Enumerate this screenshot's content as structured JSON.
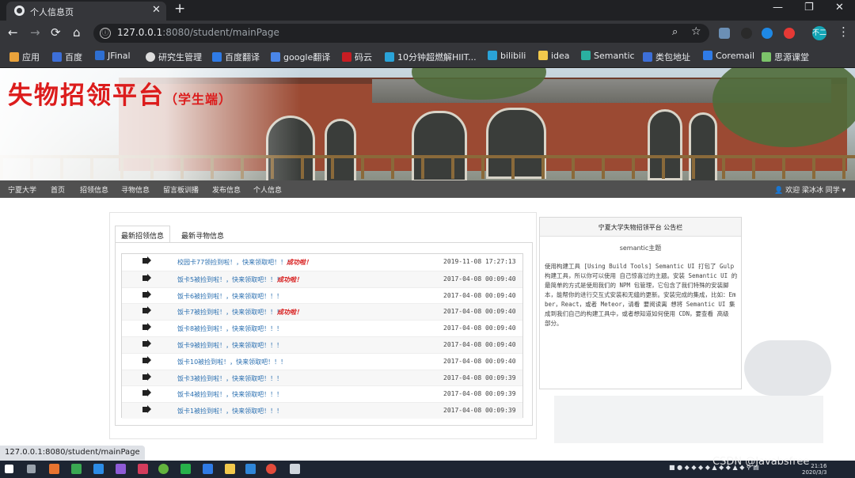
{
  "browser": {
    "tab_title": "个人信息页",
    "tab_close": "✕",
    "new_tab": "+",
    "window_controls": [
      "—",
      "❐",
      "✕"
    ],
    "nav_back": "←",
    "nav_forward": "→",
    "nav_reload": "⟳",
    "nav_home": "⌂",
    "lock_glyph": "ⓘ",
    "url_host": "127.0.0.1",
    "url_rest": ":8080/student/mainPage",
    "zoom_glyph": "⌕",
    "star_glyph": "☆",
    "profile": "不二",
    "menu_glyph": "⋮",
    "status_url": "127.0.0.1:8080/student/mainPage"
  },
  "bookmarks": [
    {
      "label": "应用",
      "color": "#e9a23b"
    },
    {
      "label": "百度",
      "color": "#3d6fd8"
    },
    {
      "label": "JFinal",
      "color": "#2e6fd1"
    },
    {
      "label": "研究生管理",
      "color": "#dddddd"
    },
    {
      "label": "百度翻译",
      "color": "#2f7be6"
    },
    {
      "label": "google翻译",
      "color": "#4a86e8"
    },
    {
      "label": "码云",
      "color": "#c71d23"
    },
    {
      "label": "10分钟超燃解HIIT...",
      "color": "#2aa3d8"
    },
    {
      "label": "bilibili",
      "color": "#2aa3d8"
    },
    {
      "label": "idea",
      "color": "#f2c94c"
    },
    {
      "label": "Semantic",
      "color": "#2ab0a0"
    },
    {
      "label": "类包地址",
      "color": "#3d6fd8"
    },
    {
      "label": "Coremail",
      "color": "#2f7be6"
    },
    {
      "label": "思源课堂",
      "color": "#7cc46a"
    }
  ],
  "site": {
    "title": "失物招领平台",
    "subtitle": "（学生端）",
    "nav_items": [
      "宁夏大学",
      "首页",
      "招领信息",
      "寻物信息",
      "留言板训播",
      "发布信息",
      "个人信息"
    ],
    "user_greeting": "欢迎 梁冰冰 同学 ▾"
  },
  "tabs": {
    "active": "最新招领信息",
    "inactive": "最新寻物信息"
  },
  "found_list": [
    {
      "title": "校园卡77领捡到啦！，快来领取吧！！！",
      "badge": "成功啦！",
      "time": "2019-11-08 17:27:13"
    },
    {
      "title": "饭卡5被捡到啦！，快来领取吧！！！",
      "badge": "成功啦！",
      "time": "2017-04-08 00:09:40"
    },
    {
      "title": "饭卡6被捡到啦！，快来领取吧！！！",
      "badge": "",
      "time": "2017-04-08 00:09:40"
    },
    {
      "title": "饭卡7被捡到啦！，快来领取吧！！！",
      "badge": "成功啦！",
      "time": "2017-04-08 00:09:40"
    },
    {
      "title": "饭卡8被捡到啦！，快来领取吧！！！",
      "badge": "",
      "time": "2017-04-08 00:09:40"
    },
    {
      "title": "饭卡9被捡到啦！，快来领取吧！！！",
      "badge": "",
      "time": "2017-04-08 00:09:40"
    },
    {
      "title": "饭卡10被捡到啦！，快来领取吧！！！",
      "badge": "",
      "time": "2017-04-08 00:09:40"
    },
    {
      "title": "饭卡3被捡到啦！，快来领取吧！！！",
      "badge": "",
      "time": "2017-04-08 00:09:39"
    },
    {
      "title": "饭卡4被捡到啦！，快来领取吧！！！",
      "badge": "",
      "time": "2017-04-08 00:09:39"
    },
    {
      "title": "饭卡1被捡到啦！，快来领取吧！！！",
      "badge": "",
      "time": "2017-04-08 00:09:39"
    }
  ],
  "notice": {
    "title": "宁夏大学失物招领平台 公告栏",
    "subtitle": "semantic主题",
    "body": "使用构建工具 [Using Build Tools] Semantic UI 打包了 Gulp 构建工具，所以你可以使用 自己惊喜过的主题。安装 Semantic UI 的最简单的方式是使用我们的 NPM 包管理，它包含了我们特殊的安装脚本，能帮你的进行交互式安装和无缝的更新。安装完成的集成，比如：Ember，React，或者 Meteor，请看 要阅读离 想将 Semantic UI 集成到我们自己的构建工具中，或者想知道如何使用 CDN，要查看 高级 部分。"
  },
  "watermark": "CSDN @Javabsfree",
  "clock": {
    "time": "21:16",
    "date": "2020/3/3"
  }
}
